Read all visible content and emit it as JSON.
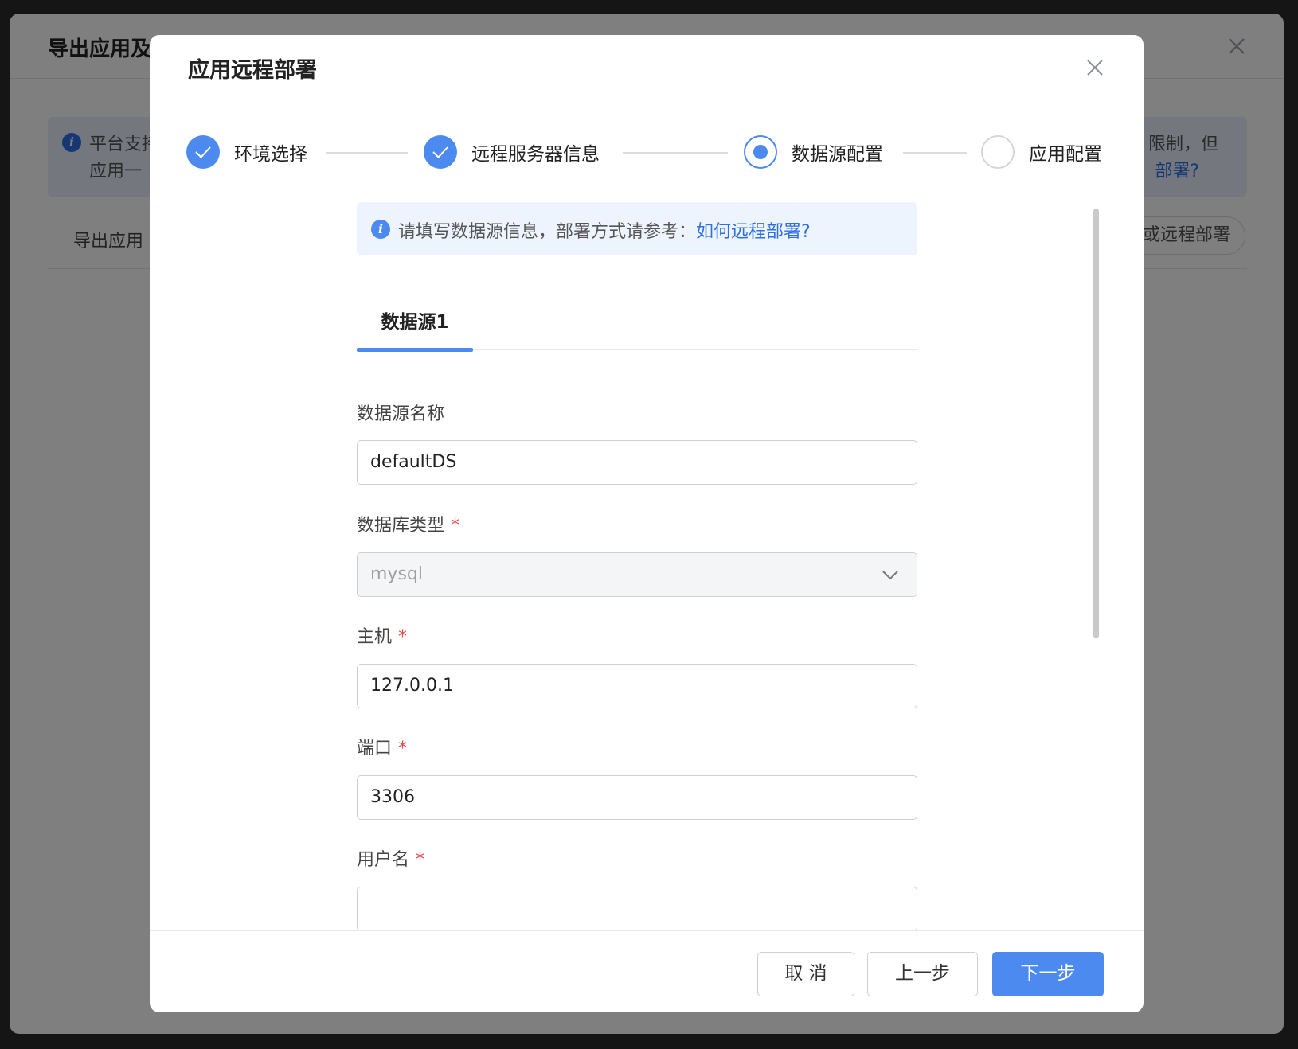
{
  "background": {
    "title": "导出应用及",
    "info_line1": "平台支持",
    "info_line2": "应用一",
    "info_right1": "限制，但",
    "info_right2": "部署?",
    "subtitle": "导出应用",
    "action_button": "或远程部署"
  },
  "modal": {
    "title": "应用远程部署",
    "steps": [
      {
        "label": "环境选择",
        "state": "done"
      },
      {
        "label": "远程服务器信息",
        "state": "done"
      },
      {
        "label": "数据源配置",
        "state": "active"
      },
      {
        "label": "应用配置",
        "state": "todo"
      }
    ],
    "info": {
      "text": "请填写数据源信息，部署方式请参考：",
      "link": "如何远程部署?"
    },
    "tabs": [
      {
        "label": "数据源1"
      }
    ],
    "form": {
      "ds_name": {
        "label": "数据源名称",
        "value": "defaultDS",
        "required": false
      },
      "db_type": {
        "label": "数据库类型",
        "value": "mysql",
        "required": true
      },
      "host": {
        "label": "主机",
        "value": "127.0.0.1",
        "required": true
      },
      "port": {
        "label": "端口",
        "value": "3306",
        "required": true
      },
      "username": {
        "label": "用户名",
        "value": "",
        "required": true
      }
    },
    "required_mark": "*",
    "buttons": {
      "cancel": "取 消",
      "prev": "上一步",
      "next": "下一步"
    }
  },
  "colors": {
    "primary": "#4d8af0",
    "required": "#e5484d",
    "link": "#2f6fe4"
  }
}
